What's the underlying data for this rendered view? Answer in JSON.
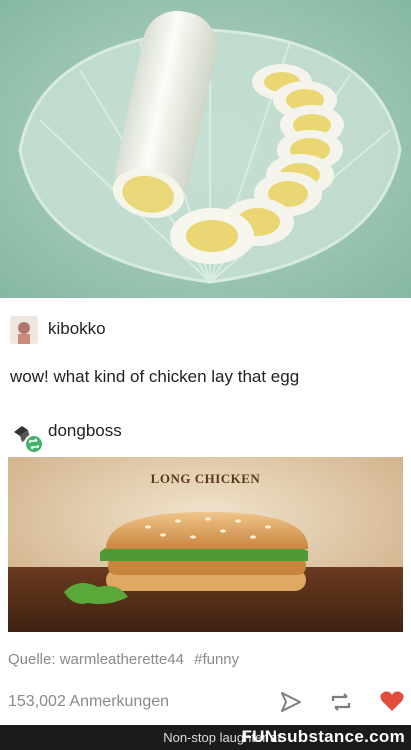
{
  "posts": [
    {
      "username": "kibokko",
      "text": "wow! what kind of chicken lay that egg"
    },
    {
      "username": "dongboss"
    }
  ],
  "ad": {
    "headline": "LONG CHICKEN"
  },
  "source": {
    "label": "Quelle:",
    "blog": "warmleatherette44",
    "tag": "#funny"
  },
  "notes": "153,002 Anmerkungen",
  "footer": {
    "text": "Non-stop laughter at",
    "brand": "FUNsubstance.com"
  },
  "icons": [
    "send-icon",
    "reblog-icon",
    "heart-icon"
  ],
  "colors": {
    "heart": "#e24d3c",
    "reblog_badge": "#43b36a"
  }
}
